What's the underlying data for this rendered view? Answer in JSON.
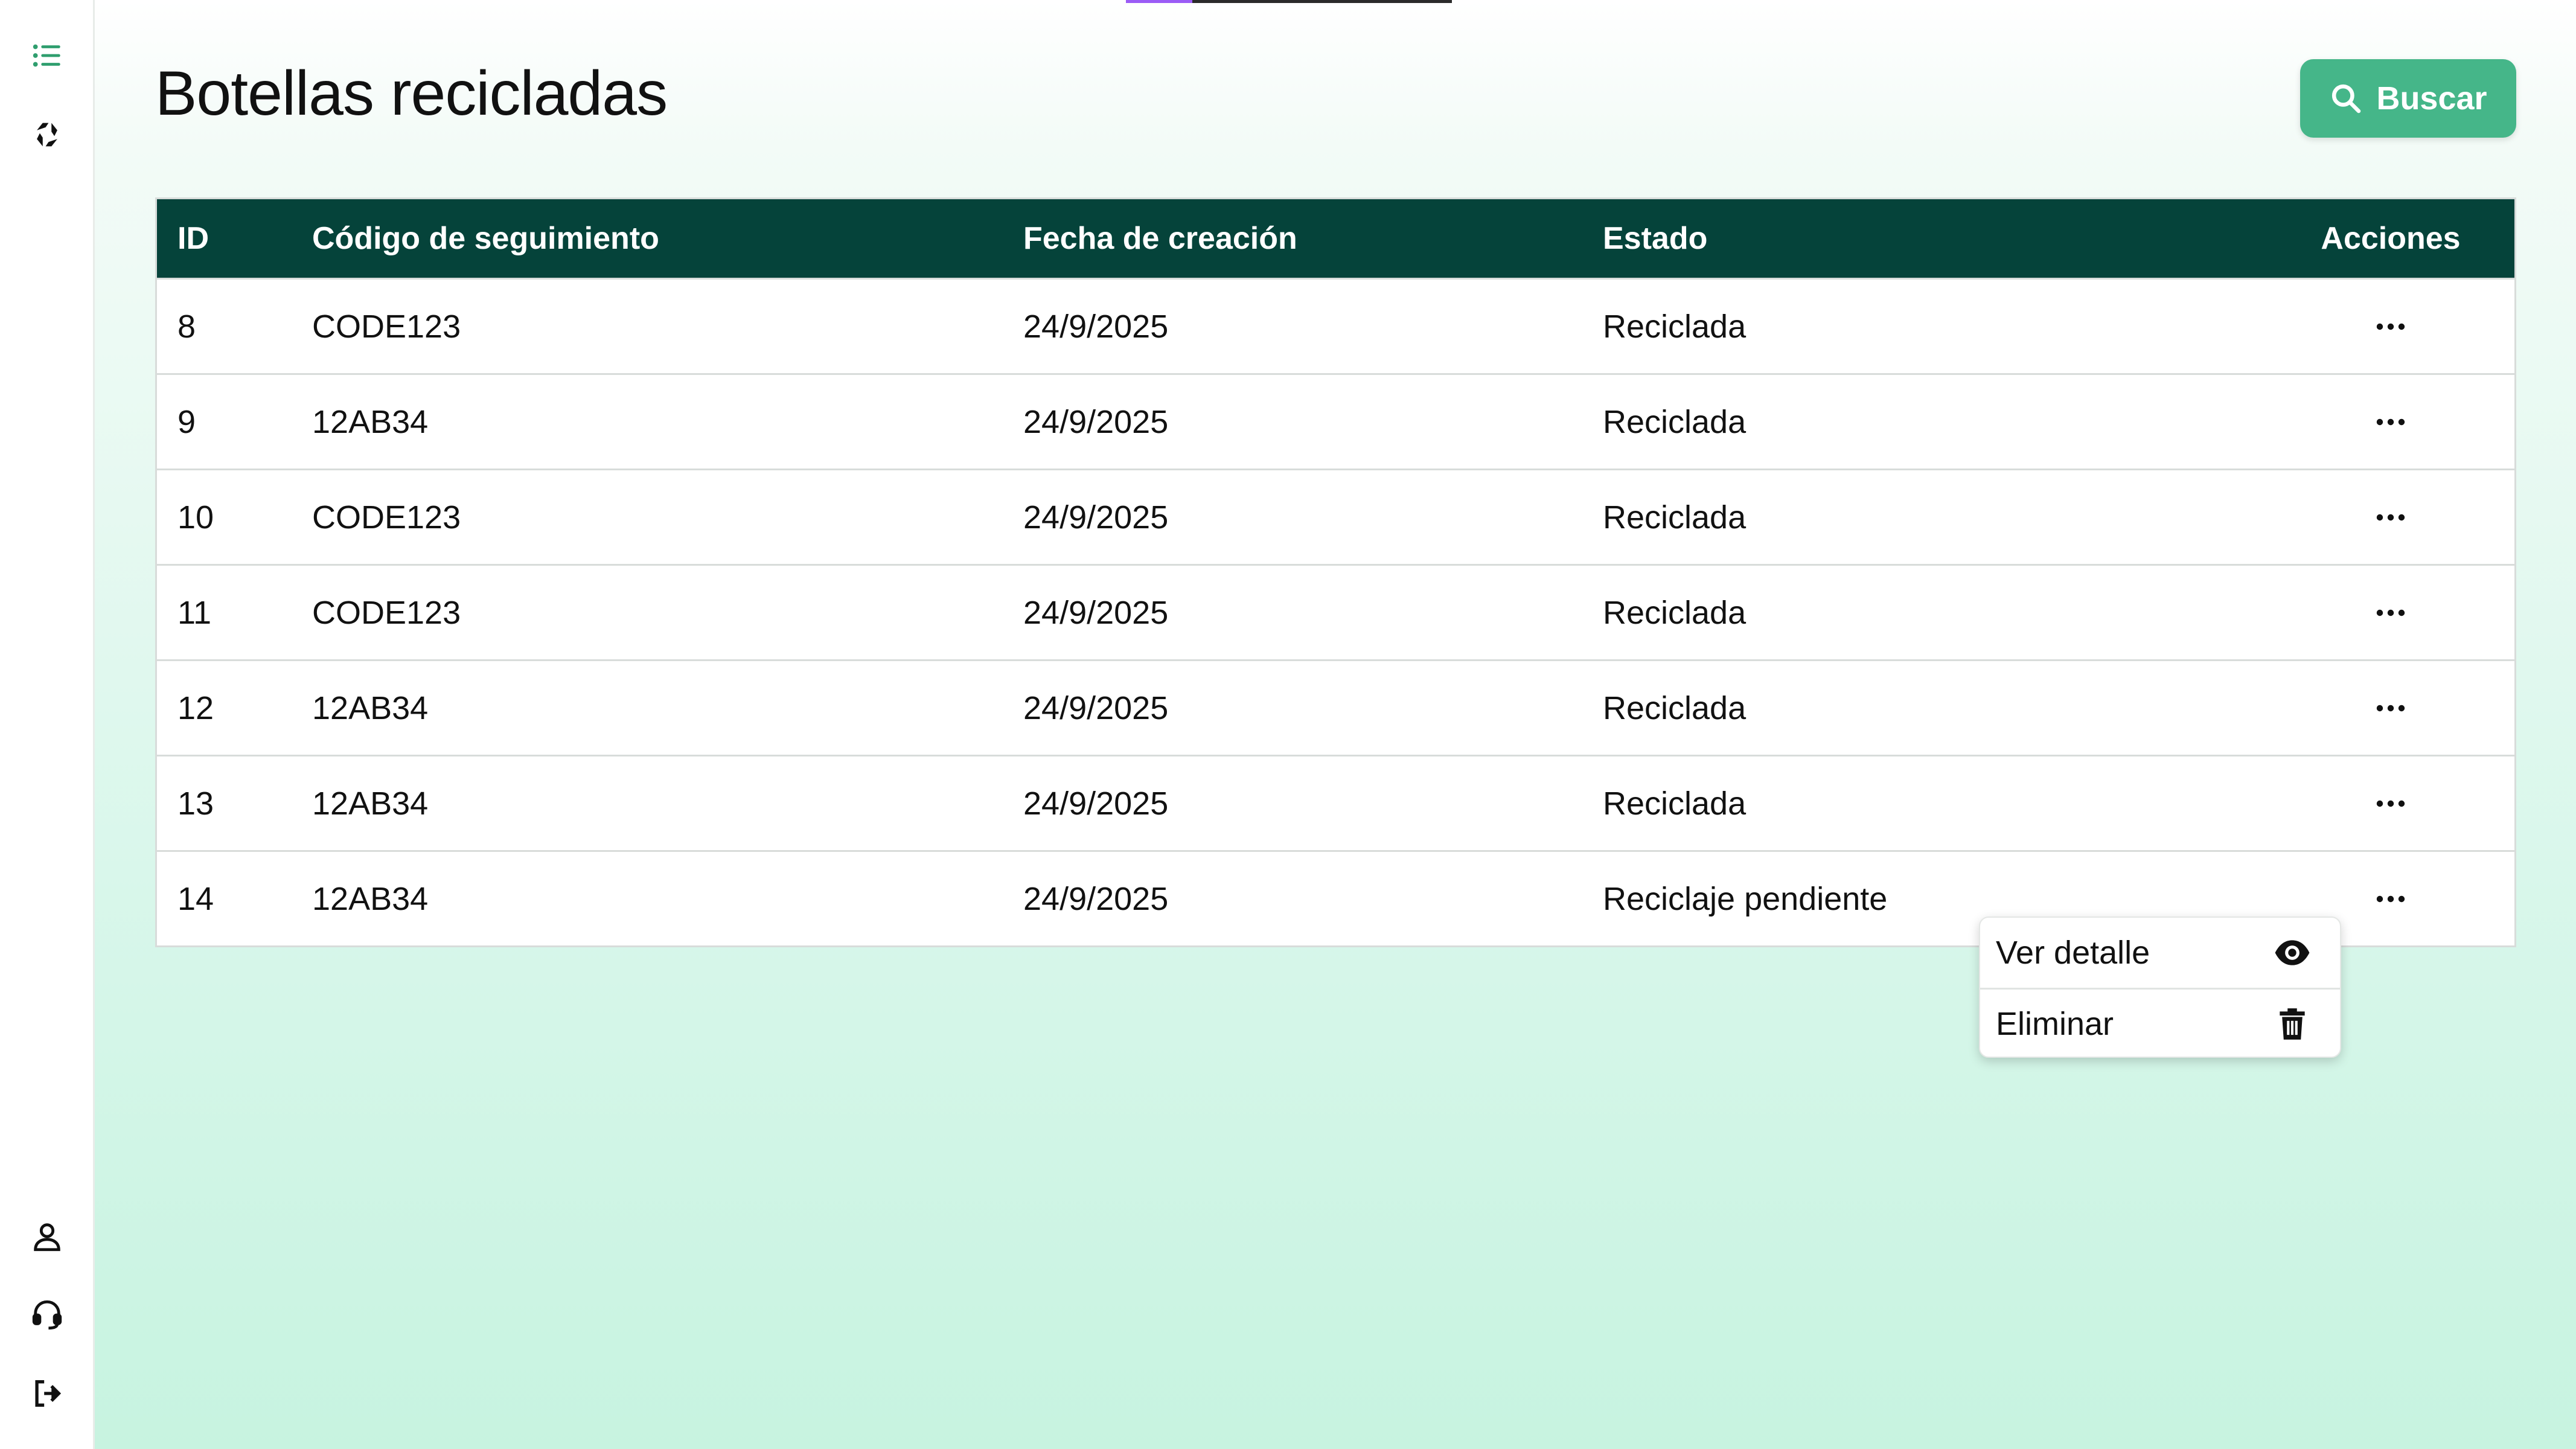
{
  "page": {
    "title": "Botellas recicladas",
    "search_label": "Buscar"
  },
  "sidebar": {
    "icons": [
      "list-icon",
      "recycle-icon",
      "user-icon",
      "support-icon",
      "logout-icon"
    ]
  },
  "table": {
    "headers": {
      "id": "ID",
      "code": "Código de seguimiento",
      "date": "Fecha de creación",
      "state": "Estado",
      "actions": "Acciones"
    },
    "rows": [
      {
        "id": "8",
        "code": "CODE123",
        "date": "24/9/2025",
        "state": "Reciclada"
      },
      {
        "id": "9",
        "code": "12AB34",
        "date": "24/9/2025",
        "state": "Reciclada"
      },
      {
        "id": "10",
        "code": "CODE123",
        "date": "24/9/2025",
        "state": "Reciclada"
      },
      {
        "id": "11",
        "code": "CODE123",
        "date": "24/9/2025",
        "state": "Reciclada"
      },
      {
        "id": "12",
        "code": "12AB34",
        "date": "24/9/2025",
        "state": "Reciclada"
      },
      {
        "id": "13",
        "code": "12AB34",
        "date": "24/9/2025",
        "state": "Reciclada"
      },
      {
        "id": "14",
        "code": "12AB34",
        "date": "24/9/2025",
        "state": "Reciclaje pendiente"
      }
    ]
  },
  "menu": {
    "view_label": "Ver detalle",
    "delete_label": "Eliminar"
  },
  "colors": {
    "accent": "#45b689",
    "header": "#05433a"
  }
}
